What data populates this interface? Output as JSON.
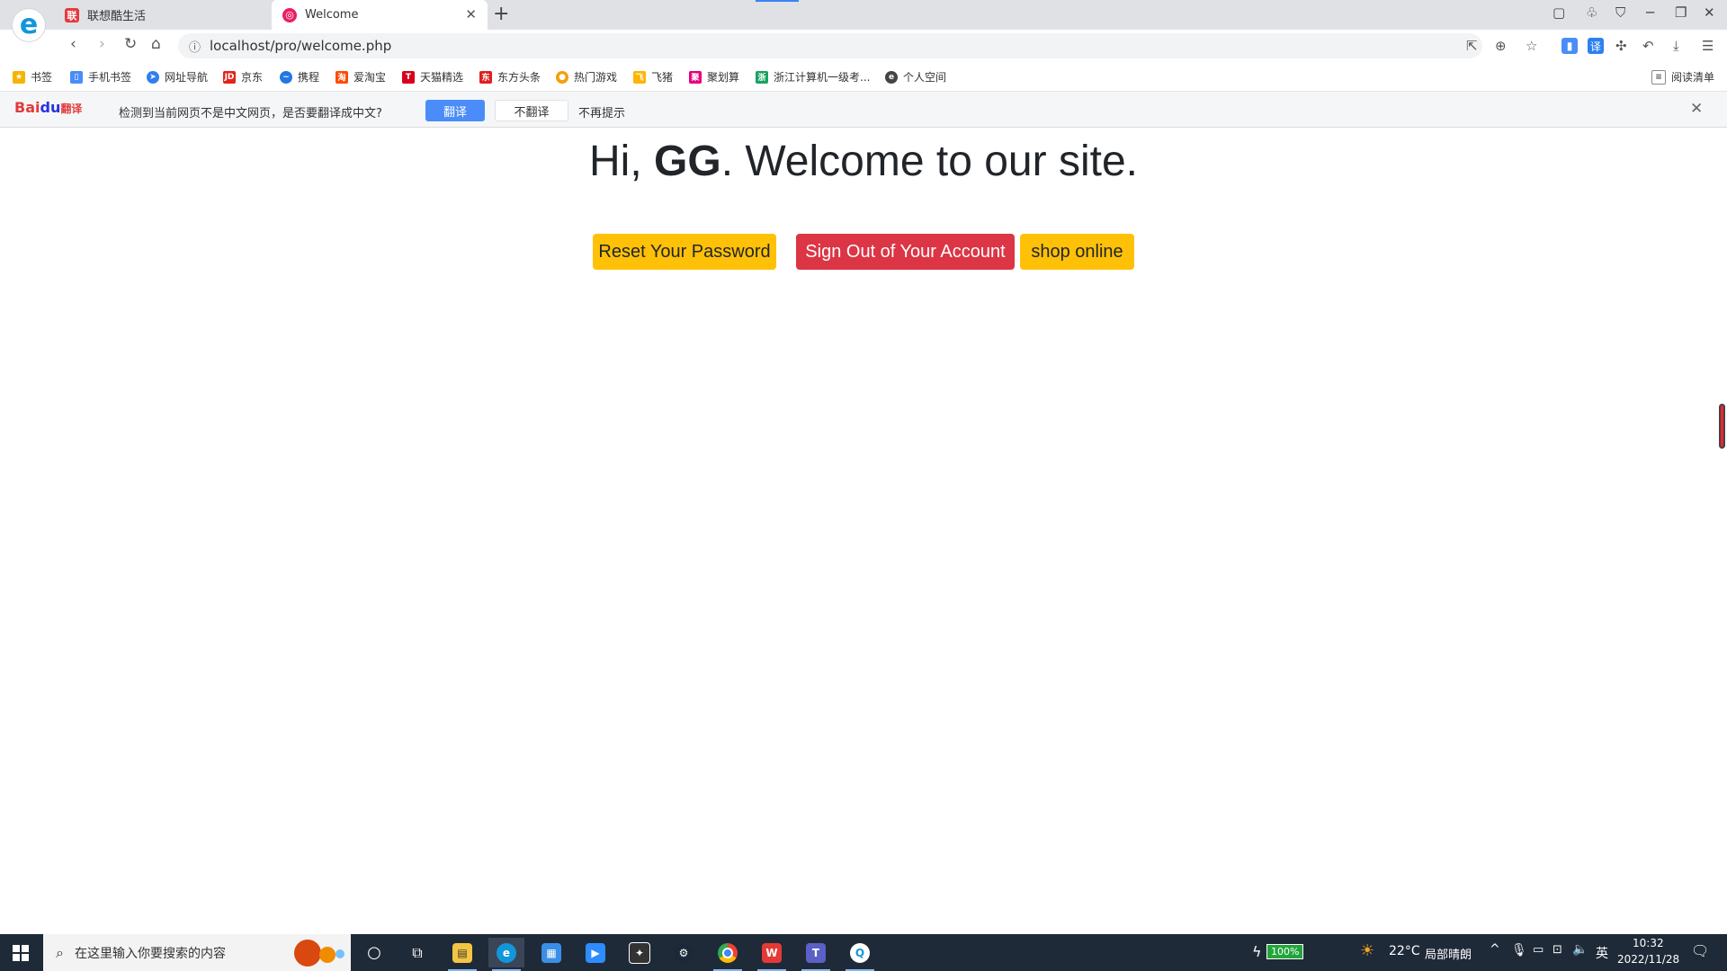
{
  "browser": {
    "tabs": [
      {
        "label": "联想酷生活",
        "active": false,
        "favicon_color": "#e4393c"
      },
      {
        "label": "Welcome",
        "active": true,
        "favicon_color": "#e91e63"
      }
    ],
    "new_tab_label": "+",
    "url": "localhost/pro/welcome.php",
    "bookmarks": [
      {
        "label": "书签",
        "icon": "star-icon",
        "color": "#f5b400"
      },
      {
        "label": "手机书签",
        "icon": "phone-icon",
        "color": "#4a8df8"
      },
      {
        "label": "网址导航",
        "icon": "compass-icon",
        "color": "#2f80ed"
      },
      {
        "label": "京东",
        "icon": "jd-icon",
        "color": "#e1251b"
      },
      {
        "label": "携程",
        "icon": "dolphin-icon",
        "color": "#2577e3"
      },
      {
        "label": "爱淘宝",
        "icon": "taobao-icon",
        "color": "#ff4a00"
      },
      {
        "label": "天猫精选",
        "icon": "tmall-icon",
        "color": "#d8001c"
      },
      {
        "label": "东方头条",
        "icon": "news-icon",
        "color": "#e02020"
      },
      {
        "label": "热门游戏",
        "icon": "game-icon",
        "color": "#f59e0b"
      },
      {
        "label": "飞猪",
        "icon": "fliggy-icon",
        "color": "#ffb400"
      },
      {
        "label": "聚划算",
        "icon": "juhuasuan-icon",
        "color": "#e4007f"
      },
      {
        "label": "浙江计算机一级考...",
        "icon": "exam-icon",
        "color": "#1aa260"
      },
      {
        "label": "个人空间",
        "icon": "edge-icon",
        "color": "#444444"
      }
    ],
    "reading_list_label": "阅读清单"
  },
  "translate_bar": {
    "logo_text": "Bai",
    "logo_paw": "du",
    "logo_suffix": "翻译",
    "message": "检测到当前网页不是中文网页，是否要翻译成中文?",
    "translate_label": "翻译",
    "no_translate_label": "不翻译",
    "never_label": "不再提示"
  },
  "page": {
    "greeting_prefix": "Hi, ",
    "username": "GG",
    "greeting_suffix": ". Welcome to our site.",
    "buttons": {
      "reset": "Reset Your Password",
      "signout": "Sign Out of Your Account",
      "shop": "shop online"
    },
    "colors": {
      "warning": "#ffc107",
      "danger": "#dc3545"
    }
  },
  "taskbar": {
    "search_placeholder": "在这里输入你要搜索的内容",
    "battery": "100%",
    "weather": "22°C",
    "weather_desc": "局部晴朗",
    "ime": "英",
    "time": "10:32",
    "date": "2022/11/28"
  }
}
